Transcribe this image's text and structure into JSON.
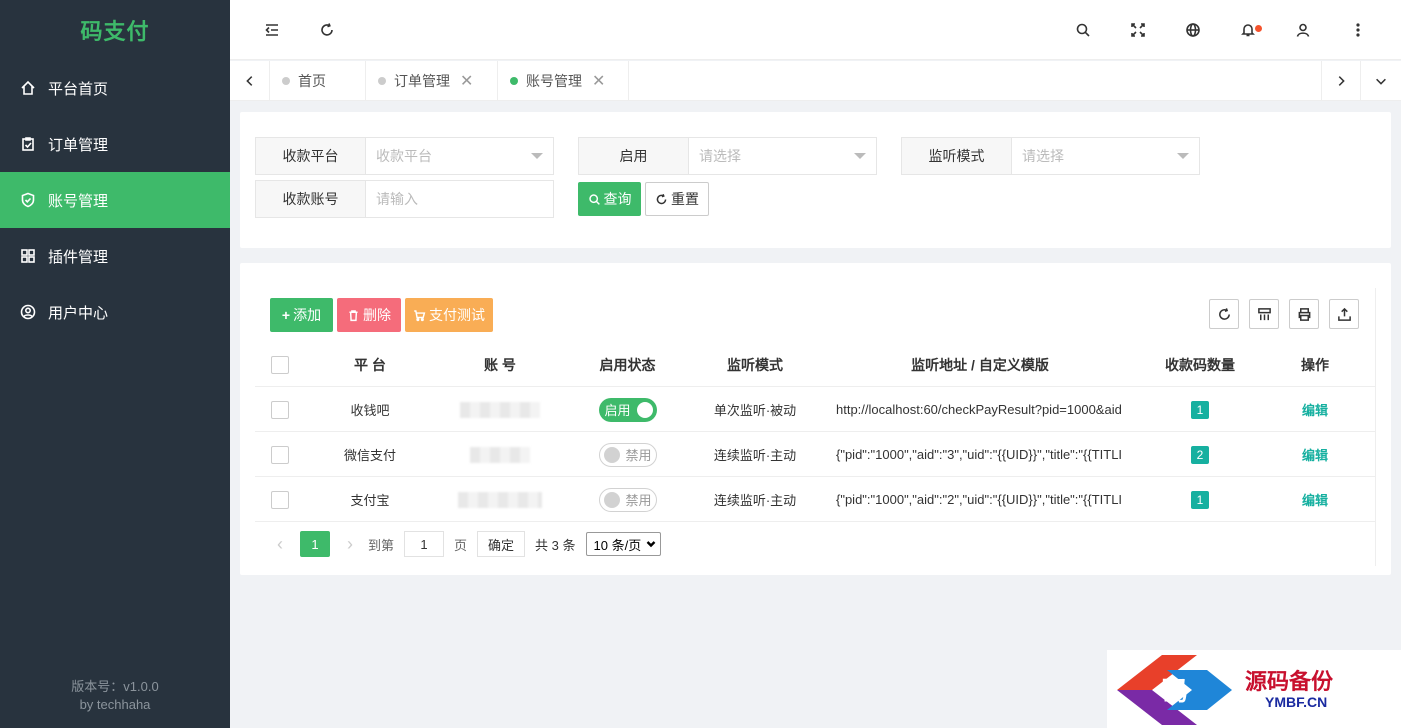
{
  "app": {
    "logo": "码支付",
    "version": "版本号：v1.0.0",
    "author": "by techhaha"
  },
  "sidebar": {
    "items": [
      {
        "label": "平台首页",
        "icon": "home-icon"
      },
      {
        "label": "订单管理",
        "icon": "clipboard-icon"
      },
      {
        "label": "账号管理",
        "icon": "shield-icon",
        "active": true
      },
      {
        "label": "插件管理",
        "icon": "grid-icon"
      },
      {
        "label": "用户中心",
        "icon": "user-circle-icon"
      }
    ]
  },
  "tabs": [
    {
      "label": "首页"
    },
    {
      "label": "订单管理",
      "close": "✕"
    },
    {
      "label": "账号管理",
      "close": "✕",
      "active": true
    }
  ],
  "search": {
    "platform_label": "收款平台",
    "platform_placeholder": "收款平台",
    "enable_label": "启用",
    "enable_placeholder": "请选择",
    "mode_label": "监听模式",
    "mode_placeholder": "请选择",
    "account_label": "收款账号",
    "account_placeholder": "请输入",
    "query_label": "查询",
    "reset_label": "重置"
  },
  "toolbar": {
    "add_label": "添加",
    "delete_label": "删除",
    "paytest_label": "支付测试"
  },
  "table": {
    "headers": [
      "平 台",
      "账 号",
      "启用状态",
      "监听模式",
      "监听地址 / 自定义模版",
      "收款码数量",
      "操作"
    ],
    "rows": [
      {
        "platform": "收钱吧",
        "status": "启用",
        "mode": "单次监听·被动",
        "address": "http://localhost:60/checkPayResult?pid=1000&aid",
        "count": "1",
        "action": "编辑"
      },
      {
        "platform": "微信支付",
        "status": "禁用",
        "mode": "连续监听·主动",
        "address": "{\"pid\":\"1000\",\"aid\":\"3\",\"uid\":\"{{UID}}\",\"title\":\"{{TITLI",
        "count": "2",
        "action": "编辑"
      },
      {
        "platform": "支付宝",
        "status": "禁用",
        "mode": "连续监听·主动",
        "address": "{\"pid\":\"1000\",\"aid\":\"2\",\"uid\":\"{{UID}}\",\"title\":\"{{TITLI",
        "count": "1",
        "action": "编辑"
      }
    ]
  },
  "pager": {
    "current": "1",
    "goto_label": "到第",
    "goto_value": "1",
    "page_unit": "页",
    "confirm": "确定",
    "total": "共 3 条",
    "per_page": "10 条/页"
  },
  "watermark": {
    "text": "源码备份",
    "sub": "YMBF.CN",
    "glyph": "码"
  },
  "colors": {
    "accent": "#3eba6a",
    "sidebar": "#28333e",
    "danger": "#f56c7b",
    "warning": "#f9ad55",
    "teal": "#16b0a0"
  }
}
